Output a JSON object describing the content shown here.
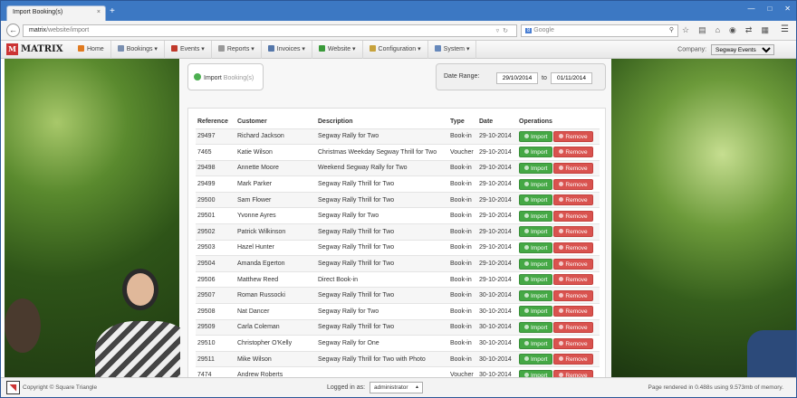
{
  "browser": {
    "tab_title": "Import Booking(s)",
    "tab_close": "×",
    "new_tab": "+",
    "url_host": "matrix",
    "url_path": "/website/import",
    "search_placeholder": "Google",
    "search_badge": "8"
  },
  "navbar": {
    "brand": "MATRIX",
    "items": [
      {
        "label": "Home",
        "color": "#e07a20"
      },
      {
        "label": "Bookings ▾",
        "color": "#7a8fb0"
      },
      {
        "label": "Events ▾",
        "color": "#c0392b"
      },
      {
        "label": "Reports ▾",
        "color": "#999999"
      },
      {
        "label": "Invoices ▾",
        "color": "#5577aa"
      },
      {
        "label": "Website ▾",
        "color": "#3a9a3a"
      },
      {
        "label": "Configuration ▾",
        "color": "#c7a23c"
      },
      {
        "label": "System ▾",
        "color": "#6688bb"
      }
    ],
    "company_label": "Company:",
    "company_value": "Segway Events"
  },
  "panel": {
    "import_label": "Import",
    "import_label_light": "Booking(s)",
    "date_range_label": "Date Range:",
    "date_from": "29/10/2014",
    "date_to_word": "to",
    "date_to": "01/11/2014"
  },
  "table": {
    "headers": [
      "Reference",
      "Customer",
      "Description",
      "Type",
      "Date",
      "Operations"
    ],
    "import_btn": "Import",
    "remove_btn": "Remove",
    "rows": [
      [
        "29497",
        "Richard Jackson",
        "Segway Rally for Two",
        "Book-in",
        "29-10-2014"
      ],
      [
        "7465",
        "Katie Wilson",
        "Christmas Weekday Segway Thrill for Two",
        "Voucher",
        "29-10-2014"
      ],
      [
        "29498",
        "Annette Moore",
        "Weekend Segway Rally for Two",
        "Book-in",
        "29-10-2014"
      ],
      [
        "29499",
        "Mark Parker",
        "Segway Rally Thrill for Two",
        "Book-in",
        "29-10-2014"
      ],
      [
        "29500",
        "Sam Flower",
        "Segway Rally Thrill for Two",
        "Book-in",
        "29-10-2014"
      ],
      [
        "29501",
        "Yvonne Ayres",
        "Segway Rally for Two",
        "Book-in",
        "29-10-2014"
      ],
      [
        "29502",
        "Patrick Wilkinson",
        "Segway Rally Thrill for Two",
        "Book-in",
        "29-10-2014"
      ],
      [
        "29503",
        "Hazel Hunter",
        "Segway Rally Thrill for Two",
        "Book-in",
        "29-10-2014"
      ],
      [
        "29504",
        "Amanda Egerton",
        "Segway Rally Thrill for Two",
        "Book-in",
        "29-10-2014"
      ],
      [
        "29506",
        "Matthew Reed",
        "Direct Book-in",
        "Book-in",
        "29-10-2014"
      ],
      [
        "29507",
        "Roman Russocki",
        "Segway Rally Thrill for Two",
        "Book-in",
        "30-10-2014"
      ],
      [
        "29508",
        "Nat Dancer",
        "Segway Rally for Two",
        "Book-in",
        "30-10-2014"
      ],
      [
        "29509",
        "Carla Coleman",
        "Segway Rally Thrill for Two",
        "Book-in",
        "30-10-2014"
      ],
      [
        "29510",
        "Christopher O'Kelly",
        "Segway Rally for One",
        "Book-in",
        "30-10-2014"
      ],
      [
        "29511",
        "Mike Wilson",
        "Segway Rally Thrill for Two with Photo",
        "Book-in",
        "30-10-2014"
      ],
      [
        "7474",
        "Andrew Roberts",
        "",
        "Voucher",
        "30-10-2014"
      ]
    ]
  },
  "footer": {
    "copyright": "Copyright © Square Triangle",
    "logged_in_label": "Logged in as:",
    "user": "administrator",
    "render_info": "Page rendered in 0.488s using 9.573mb of memory."
  }
}
